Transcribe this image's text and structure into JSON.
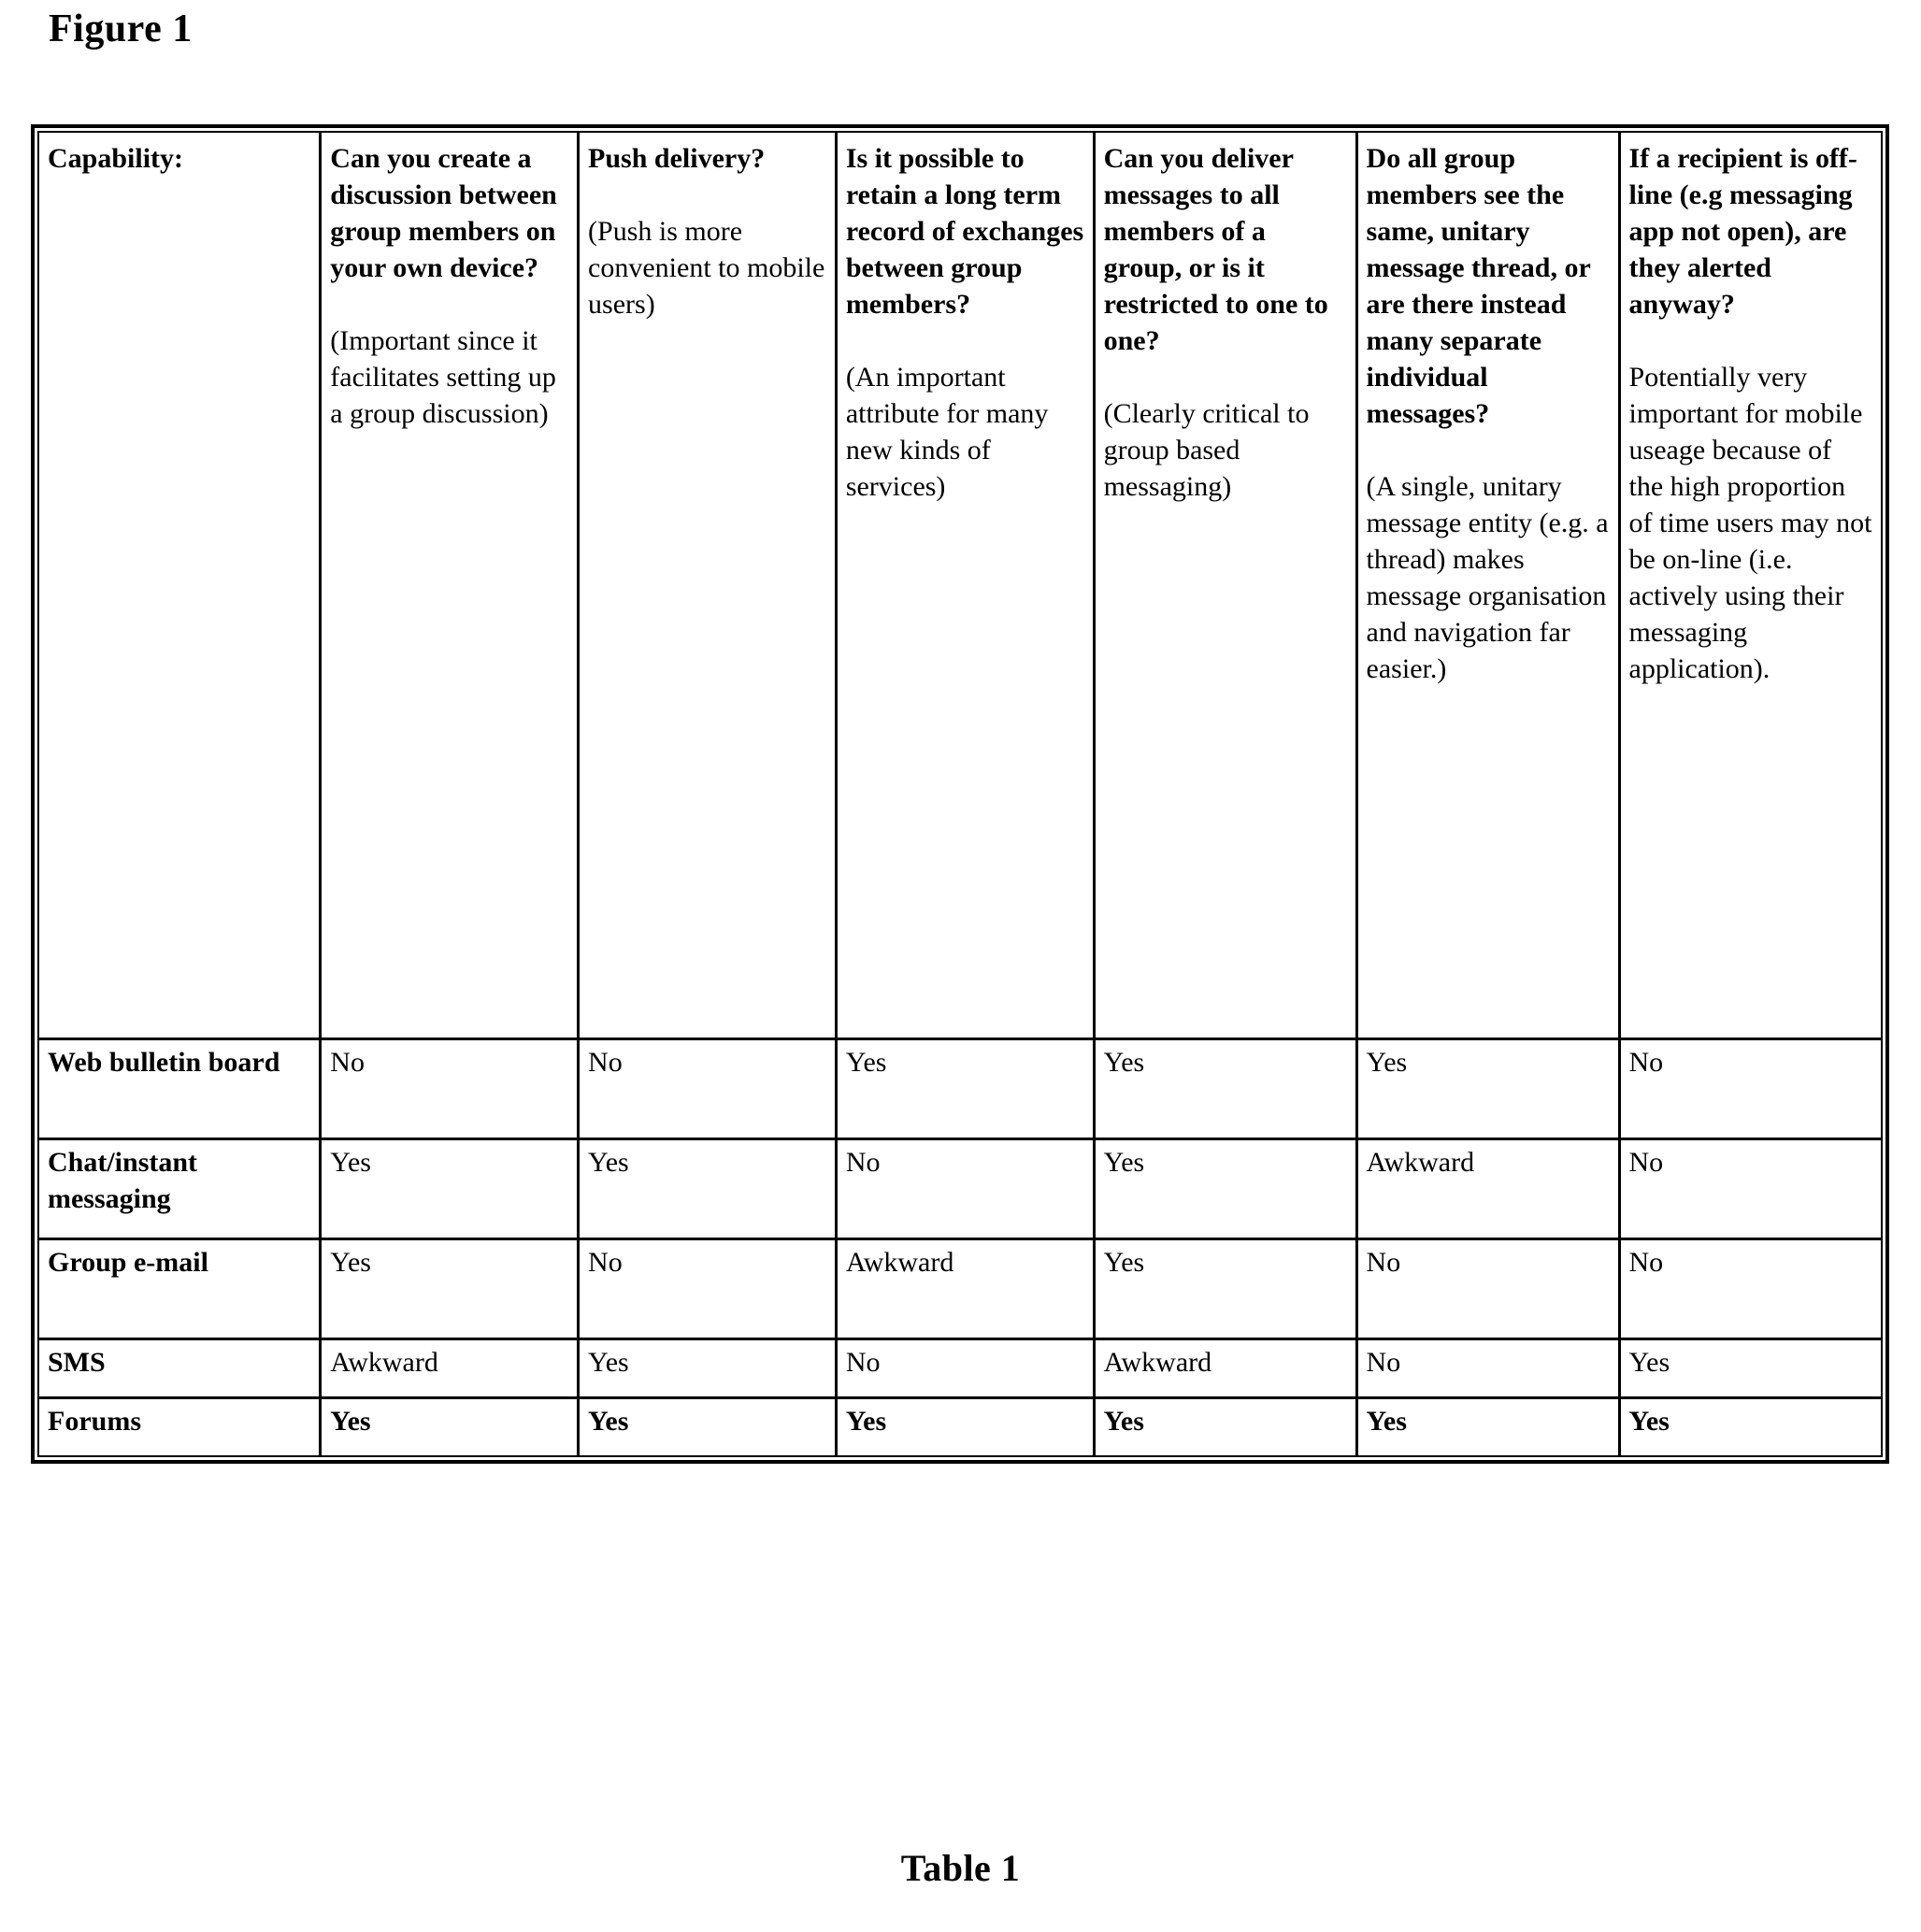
{
  "figure": {
    "title": "Figure 1"
  },
  "caption": {
    "text": "Table 1"
  },
  "table": {
    "corner_label": "Capability:",
    "columns": [
      {
        "question": "Can you create a discussion between group members on your own device?",
        "note": "(Important since it facilitates setting up a group discussion)"
      },
      {
        "question": "Push delivery?",
        "note": "(Push is more convenient to mobile users)"
      },
      {
        "question": "Is it possible to retain a long term record of exchanges between group members?",
        "note": "(An important attribute for many new kinds of services)"
      },
      {
        "question": "Can you deliver messages to all members of a group, or is it restricted to one to one?",
        "note": "(Clearly critical to group based messaging)"
      },
      {
        "question": "Do all group members see the same, unitary message thread, or are there instead many separate individual messages?",
        "note": "(A single, unitary message entity (e.g. a thread) makes message organisation and navigation far easier.)"
      },
      {
        "question": "If a recipient is off-line (e.g messaging app not open), are they alerted anyway?",
        "note": "Potentially very important for mobile useage because of the high proportion of time users may not be on-line (i.e. actively using their messaging application)."
      }
    ],
    "rows": [
      {
        "label": "Web bulletin board",
        "bold": false,
        "values": [
          "No",
          "No",
          "Yes",
          "Yes",
          "Yes",
          "No"
        ]
      },
      {
        "label": "Chat/instant messaging",
        "bold": false,
        "values": [
          "Yes",
          "Yes",
          "No",
          "Yes",
          "Awkward",
          "No"
        ]
      },
      {
        "label": "Group e-mail",
        "bold": false,
        "values": [
          "Yes",
          "No",
          "Awkward",
          "Yes",
          "No",
          "No"
        ]
      },
      {
        "label": "SMS",
        "bold": false,
        "values": [
          "Awkward",
          "Yes",
          "No",
          "Awkward",
          "No",
          "Yes"
        ]
      },
      {
        "label": "Forums",
        "bold": true,
        "values": [
          "Yes",
          "Yes",
          "Yes",
          "Yes",
          "Yes",
          "Yes"
        ]
      }
    ]
  }
}
